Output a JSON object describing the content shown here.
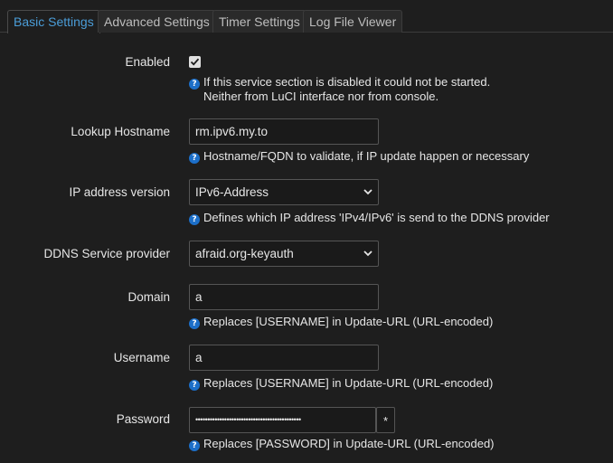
{
  "tabs": [
    {
      "label": "Basic Settings",
      "active": true
    },
    {
      "label": "Advanced Settings",
      "active": false
    },
    {
      "label": "Timer Settings",
      "active": false
    },
    {
      "label": "Log File Viewer",
      "active": false
    }
  ],
  "form": {
    "enabled": {
      "label": "Enabled",
      "checked": true,
      "hint_line1": "If this service section is disabled it could not be started.",
      "hint_line2": "Neither from LuCI interface nor from console."
    },
    "lookup_hostname": {
      "label": "Lookup Hostname",
      "value": "rm.ipv6.my.to",
      "hint": "Hostname/FQDN to validate, if IP update happen or necessary"
    },
    "ip_version": {
      "label": "IP address version",
      "value": "IPv6-Address",
      "hint": "Defines which IP address 'IPv4/IPv6' is send to the DDNS provider"
    },
    "service_provider": {
      "label": "DDNS Service provider",
      "value": "afraid.org-keyauth"
    },
    "domain": {
      "label": "Domain",
      "value": "a",
      "hint": "Replaces [USERNAME] in Update-URL (URL-encoded)"
    },
    "username": {
      "label": "Username",
      "value": "a",
      "hint": "Replaces [USERNAME] in Update-URL (URL-encoded)"
    },
    "password": {
      "label": "Password",
      "value": "••••••••••••••••••••••••••••••••••••••••••••",
      "toggle": "*",
      "hint": "Replaces [PASSWORD] in Update-URL (URL-encoded)"
    }
  },
  "colors": {
    "background": "#1e1e1e",
    "active_tab": "#4b9dd8",
    "help_icon": "#1c6fc9"
  },
  "icons": {
    "help": "question-circle-icon",
    "check": "checkmark-icon",
    "dropdown": "chevron-down-icon"
  }
}
